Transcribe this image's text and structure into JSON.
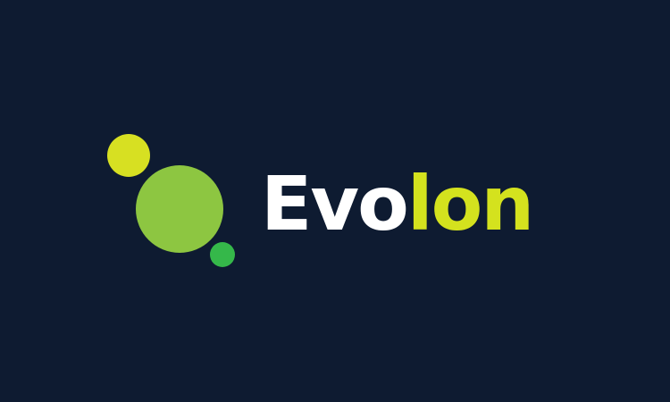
{
  "brand": {
    "name_part_1": "Evo",
    "name_part_2": "lon"
  },
  "colors": {
    "background": "#0e1b31",
    "text_primary": "#ffffff",
    "text_accent": "#d4e21e",
    "dot_yellow": "#d7e022",
    "dot_lime": "#8dc641",
    "dot_green": "#35b84a"
  },
  "icons": {
    "logo_mark": "three-circles-logo-icon"
  }
}
